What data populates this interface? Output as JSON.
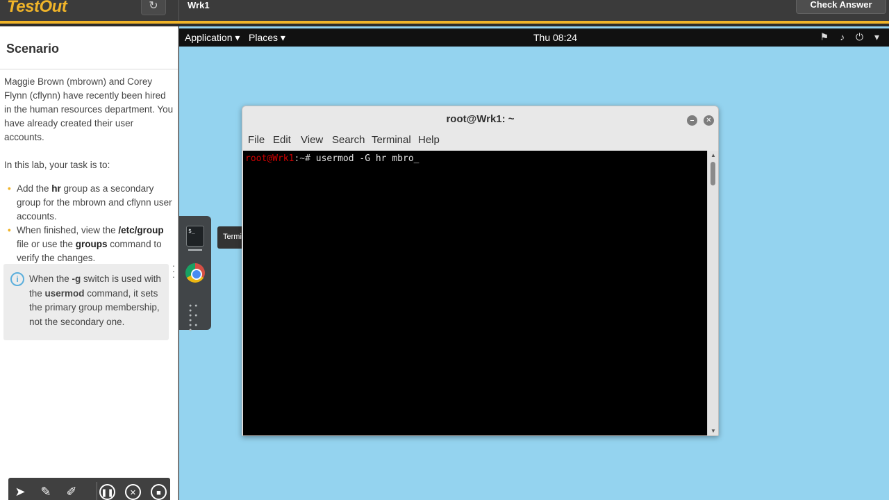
{
  "app": {
    "logo": "TestOut",
    "refresh_icon": "↻",
    "machine": "Wrk1",
    "check_answer": "Check Answer"
  },
  "scenario": {
    "heading": "Scenario",
    "intro": "Maggie Brown (mbrown) and Corey Flynn (cflynn) have recently been hired in the human resources department. You have already created their user accounts.",
    "task_intro": "In this lab, your task is to:",
    "tasks": [
      {
        "pre": "Add the ",
        "bold": "hr",
        "post": " group as a secondary group for the mbrown and cflynn user accounts."
      },
      {
        "pre": "When finished, view the ",
        "bold": "/etc/group",
        "mid": " file or use the ",
        "bold2": "groups",
        "post": " command to verify the changes."
      }
    ],
    "hint": {
      "pre": "When the ",
      "b1": "-g",
      "mid": " switch is used with the ",
      "b2": "usermod",
      "post": " command, it sets the primary group membership, not the secondary one."
    }
  },
  "toolbar": {
    "icons": [
      "pointer-icon",
      "pencil-icon",
      "brush-icon",
      "pause-icon",
      "close-circle-icon",
      "stop-icon"
    ]
  },
  "desktop": {
    "menu_application": "Application ▾",
    "menu_places": "Places ▾",
    "clock": "Thu 08:24",
    "tray": "⚑ ♪ ⏻ ▾",
    "dock_tooltip": "Terminal",
    "terminal_glyph": "$_"
  },
  "terminal": {
    "title": "root@Wrk1: ~",
    "menu": [
      "File",
      "Edit",
      "View",
      "Search",
      "Terminal",
      "Help"
    ],
    "prompt_user": "root@Wrk1",
    "prompt_rest": ":~# ",
    "command": "usermod -G hr mbro_"
  },
  "colors": {
    "accent": "#f0b429",
    "desktop_bg": "#94d3ef",
    "prompt_red": "#d10000"
  }
}
